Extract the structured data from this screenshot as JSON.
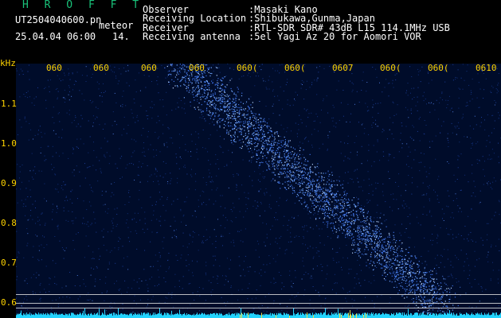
{
  "header": {
    "brand": "H R O F F T",
    "file_name": "UT2504040600.pn",
    "meteor_tag": "meteor",
    "date_time": "25.04.04 06:00",
    "count": "14.",
    "labels": [
      "Observer",
      "Receiving Location",
      "Receiver",
      "Receiving antenna"
    ],
    "values": [
      ":Masaki Kano",
      ":Shibukawa,Gunma,Japan",
      ":RTL-SDR SDR# 43dB L15 114.1MHz USB",
      ":5el Yagi Az 20 for Aomori VOR"
    ]
  },
  "spectrogram": {
    "unit": "kHz",
    "time_ticks": [
      "060",
      "060",
      "060",
      "060",
      "060(",
      "060(",
      "0607",
      "060(",
      "060(",
      "0610"
    ],
    "freq_ticks": [
      "1.1",
      "1.0",
      "0.9",
      "0.8",
      "0.7",
      "0.6"
    ],
    "colors": {
      "background": "#000c2a",
      "signal": "#6fa6ff",
      "baseline": "#22d3ff"
    }
  }
}
